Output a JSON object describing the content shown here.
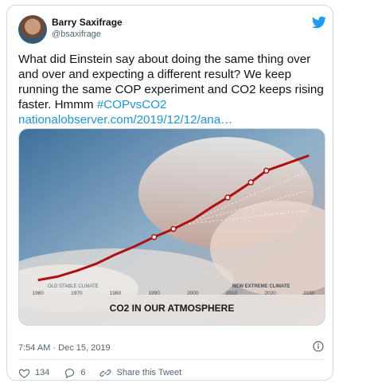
{
  "tweet": {
    "author_name": "Barry Saxifrage",
    "author_handle": "@bsaxifrage",
    "text": "What did Einstein say about doing the same thing over and over and expecting a different result? We keep running the same COP experiment and CO2 keeps rising faster. Hmmm ",
    "hashtag": "#COPvsCO2",
    "link": "nationalobserver.com/2019/12/12/ana…",
    "timestamp": "7:54 AM · Dec 15, 2019"
  },
  "actions": {
    "likes": "134",
    "replies": "6",
    "share_label": "Share this Tweet"
  },
  "chart_data": {
    "type": "line",
    "title": "CO2 IN OUR ATMOSPHERE",
    "xlabel": "",
    "ylabel": "",
    "x_ticks": [
      "1960",
      "1970",
      "1980",
      "1990",
      "2000",
      "2010",
      "2020",
      "2030"
    ],
    "xlim": [
      1958,
      2032
    ],
    "annotations": [
      "OLD STABLE CLIMATE",
      "NEW EXTREME CLIMATE"
    ],
    "series": [
      {
        "x": [
          1960,
          1965,
          1970,
          1975,
          1980,
          1985,
          1990,
          1995,
          2000,
          2005,
          2010,
          2015,
          2019
        ],
        "values": [
          317,
          320,
          325,
          331,
          339,
          346,
          354,
          361,
          369,
          380,
          390,
          401,
          411
        ]
      }
    ],
    "ylim": [
      310,
      440
    ],
    "colors": {
      "line": "#b01010",
      "marker_fill": "#ffffff"
    }
  }
}
